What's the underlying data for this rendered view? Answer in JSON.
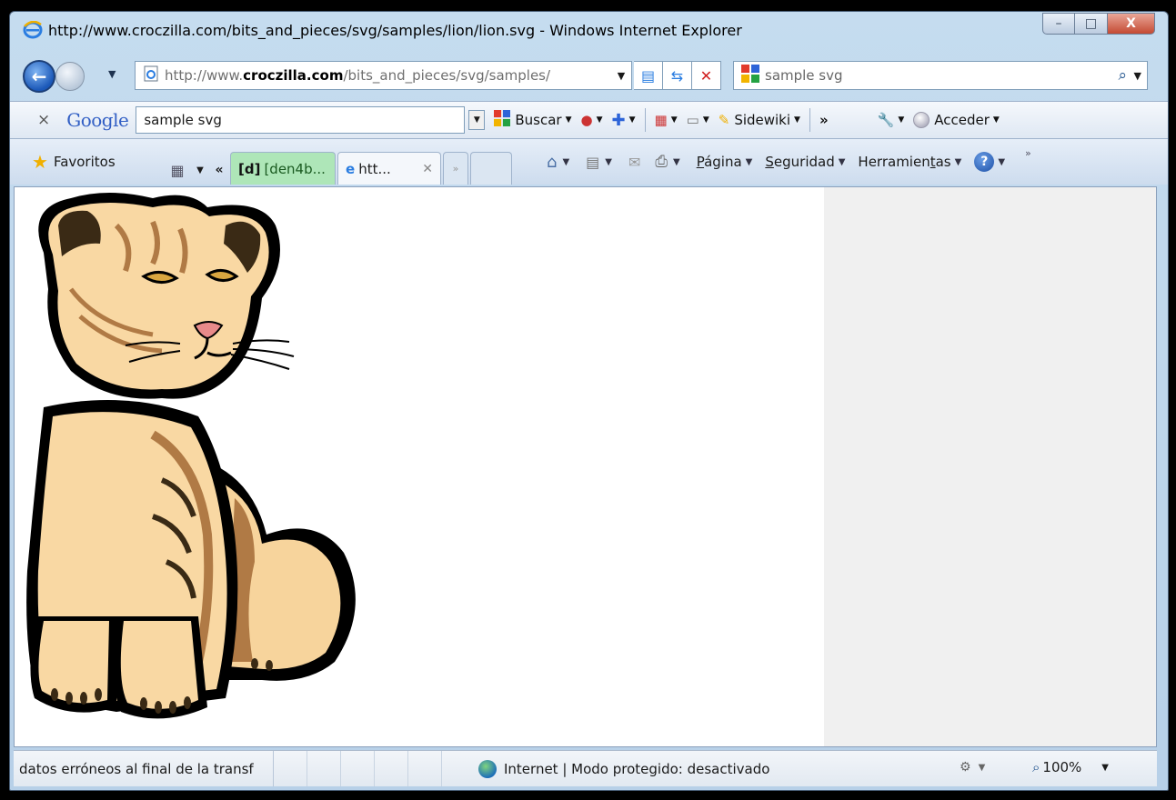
{
  "window": {
    "title": "http://www.croczilla.com/bits_and_pieces/svg/samples/lion/lion.svg - Windows Internet Explorer",
    "controls": {
      "minimize": "–",
      "maximize": "□",
      "close": "X"
    }
  },
  "address_bar": {
    "url_prefix": "http://www.",
    "url_domain": "croczilla.com",
    "url_suffix": "/bits_and_pieces/svg/samples/",
    "search_value": "sample svg"
  },
  "google_toolbar": {
    "close": "×",
    "logo": "Google",
    "query": "sample svg",
    "search_button": "Buscar",
    "sidewiki": "Sidewiki",
    "more": "»",
    "sign_in": "Acceder"
  },
  "command_bar": {
    "favorites": "Favoritos",
    "tabs": [
      {
        "label_bold": "[d]",
        "label": "[den4b...",
        "color": "#aee6b8"
      },
      {
        "label": "htt...",
        "active": true
      }
    ],
    "tab_overflow": "»",
    "menus": [
      {
        "label": "Página",
        "mnemonic": "P"
      },
      {
        "label": "Seguridad",
        "mnemonic": "S"
      },
      {
        "label": "Herramientas",
        "mnemonic": "t"
      }
    ],
    "toolbar_more": "»"
  },
  "status_bar": {
    "message": "datos erróneos al final de la transf",
    "zone": "Internet | Modo protegido: desactivado",
    "zoom": "100%"
  },
  "colors": {
    "frame": "#b7d0e8",
    "content_bg": "#ffffff",
    "side_pane_bg": "#f0f0f0",
    "lion_fur": "#f9d8a3",
    "lion_shadow": "#b07a45",
    "lion_outline": "#000000",
    "lion_nose": "#e88a8a"
  },
  "icons": [
    "ie-logo",
    "back-arrow",
    "forward-arrow",
    "refresh",
    "compatibility",
    "stop",
    "search-magnifier",
    "google-icon",
    "favorites-star",
    "quick-tabs",
    "home",
    "feeds",
    "mail",
    "print",
    "help",
    "globe",
    "zoom-magnifier",
    "protected-mode"
  ]
}
